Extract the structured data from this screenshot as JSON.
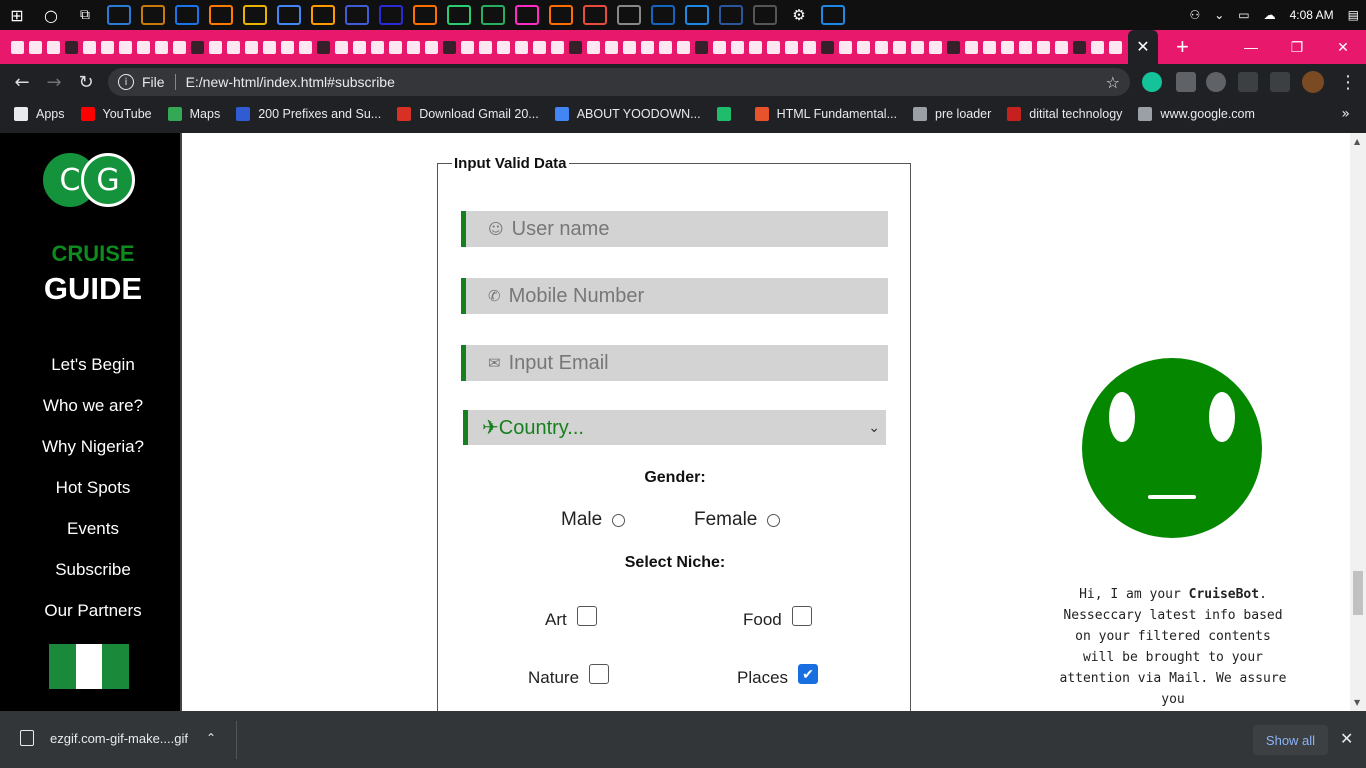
{
  "os": {
    "clock": "4:08 AM",
    "taskbar_icons": [
      "windows-start-icon",
      "cortana-icon",
      "task-view-icon",
      "vscode-icon",
      "store-icon",
      "mail-icon",
      "sublime-icon",
      "file-explorer-icon",
      "chrome-icon",
      "illustrator-icon",
      "framer-icon",
      "premiere-icon",
      "vlc-icon",
      "app-icon",
      "app-icon",
      "xd-icon",
      "xampp-icon",
      "app-icon",
      "app-icon",
      "lightroom-icon",
      "app-icon",
      "word-icon",
      "app-icon",
      "settings-icon",
      "app-icon"
    ]
  },
  "browser": {
    "tab_close": "✕",
    "new_tab": "+",
    "url_scheme": "File",
    "url": "E:/new-html/index.html#subscribe",
    "bookmarks": [
      {
        "label": "Apps",
        "icon": "apps-grid-icon",
        "color": "#e8eaed"
      },
      {
        "label": "YouTube",
        "icon": "youtube-icon",
        "color": "#ff0000"
      },
      {
        "label": "Maps",
        "icon": "maps-pin-icon",
        "color": "#34a853"
      },
      {
        "label": "200 Prefixes and Su...",
        "icon": "dbt-icon",
        "color": "#2f5bd3"
      },
      {
        "label": "Download Gmail 20...",
        "icon": "gmail-icon",
        "color": "#d93025"
      },
      {
        "label": "ABOUT YOODOWN...",
        "icon": "google-icon",
        "color": "#4285f4"
      },
      {
        "label": "",
        "icon": "vuetify-icon",
        "color": "#1fbc6c"
      },
      {
        "label": "HTML Fundamental...",
        "icon": "html-course-icon",
        "color": "#e8532b"
      },
      {
        "label": "pre loader",
        "icon": "globe-icon",
        "color": "#9aa0a6"
      },
      {
        "label": "ditital technology",
        "icon": "app-icon",
        "color": "#c5221f"
      },
      {
        "label": "www.google.com",
        "icon": "globe-icon",
        "color": "#9aa0a6"
      }
    ]
  },
  "sidebar": {
    "logo_c": "C",
    "logo_g": "G",
    "brand_top": "CRUISE",
    "brand_bottom": "GUIDE",
    "nav": [
      "Let's Begin",
      "Who we are?",
      "Why Nigeria?",
      "Hot Spots",
      "Events",
      "Subscribe",
      "Our Partners"
    ]
  },
  "form": {
    "legend": "Input Valid Data",
    "username_placeholder": "User name",
    "mobile_placeholder": "Mobile Number",
    "email_placeholder": "Input Email",
    "country_selected": "✈Country...",
    "gender_label": "Gender:",
    "gender_options": [
      "Male",
      "Female"
    ],
    "niche_label": "Select Niche:",
    "niches": [
      {
        "label": "Art",
        "checked": false
      },
      {
        "label": "Food",
        "checked": false
      },
      {
        "label": "Nature",
        "checked": false
      },
      {
        "label": "Places",
        "checked": true
      }
    ]
  },
  "bot": {
    "greeting_prefix": "Hi, I am your ",
    "name": "CruiseBot",
    "greeting_rest": ". Nesseccary latest info based on your filtered contents will be brought to your attention via Mail. We assure you"
  },
  "downloads": {
    "file": "ezgif.com-gif-make....gif",
    "show_all": "Show all"
  },
  "colors": {
    "brand_green": "#17801e",
    "bot_green": "#058700",
    "tab_strip": "#e8196d"
  }
}
